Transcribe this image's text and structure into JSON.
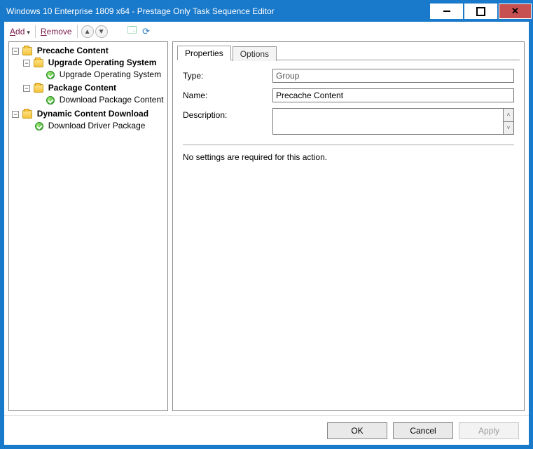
{
  "window": {
    "title": "Windows 10 Enterprise 1809 x64 - Prestage Only Task Sequence Editor"
  },
  "toolbar": {
    "add": "Add",
    "remove": "Remove"
  },
  "tree": {
    "nodes": [
      {
        "label": "Precache Content",
        "kind": "group",
        "bold": true,
        "depth": 0
      },
      {
        "label": "Upgrade Operating System",
        "kind": "group",
        "bold": true,
        "depth": 1
      },
      {
        "label": "Upgrade Operating System",
        "kind": "step",
        "bold": false,
        "depth": 2
      },
      {
        "label": "Package Content",
        "kind": "group",
        "bold": true,
        "depth": 1
      },
      {
        "label": "Download Package Content",
        "kind": "step",
        "bold": false,
        "depth": 2
      },
      {
        "label": "Dynamic Content Download",
        "kind": "group",
        "bold": true,
        "depth": 0
      },
      {
        "label": "Download Driver Package",
        "kind": "step",
        "bold": false,
        "depth": 1
      }
    ]
  },
  "tabs": {
    "properties": "Properties",
    "options": "Options"
  },
  "form": {
    "type_label": "Type:",
    "type_value": "Group",
    "name_label": "Name:",
    "name_value": "Precache Content",
    "desc_label": "Description:",
    "desc_value": "",
    "note": "No settings are required for this action."
  },
  "buttons": {
    "ok": "OK",
    "cancel": "Cancel",
    "apply": "Apply"
  }
}
